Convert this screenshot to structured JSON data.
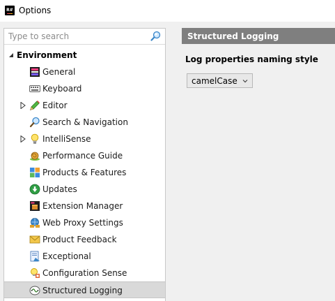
{
  "window": {
    "title": "Options",
    "icon": "resharper-icon",
    "icon_text": "R#"
  },
  "search": {
    "placeholder": "Type to search",
    "value": ""
  },
  "tree": {
    "root": {
      "label": "Environment",
      "expanded": true
    },
    "items": [
      {
        "label": "General",
        "icon": "general-icon",
        "expandable": false
      },
      {
        "label": "Keyboard",
        "icon": "keyboard-icon",
        "expandable": false
      },
      {
        "label": "Editor",
        "icon": "pencil-icon",
        "expandable": true
      },
      {
        "label": "Search & Navigation",
        "icon": "magnifier-icon",
        "expandable": false
      },
      {
        "label": "IntelliSense",
        "icon": "lightbulb-icon",
        "expandable": true
      },
      {
        "label": "Performance Guide",
        "icon": "snail-icon",
        "expandable": false
      },
      {
        "label": "Products & Features",
        "icon": "puzzle-icon",
        "expandable": false
      },
      {
        "label": "Updates",
        "icon": "update-icon",
        "expandable": false
      },
      {
        "label": "Extension Manager",
        "icon": "package-icon",
        "expandable": false
      },
      {
        "label": "Web Proxy Settings",
        "icon": "network-icon",
        "expandable": false
      },
      {
        "label": "Product Feedback",
        "icon": "envelope-icon",
        "expandable": false
      },
      {
        "label": "Exceptional",
        "icon": "exception-icon",
        "expandable": false
      },
      {
        "label": "Configuration Sense",
        "icon": "config-sense-icon",
        "expandable": false
      },
      {
        "label": "Structured Logging",
        "icon": "logging-icon",
        "expandable": false,
        "selected": true
      }
    ]
  },
  "page": {
    "title": "Structured Logging",
    "setting_label": "Log properties naming style",
    "dropdown": {
      "value": "camelCase"
    }
  },
  "colors": {
    "header_bg": "#7f7f7f",
    "selected_bg": "#d9d9d9",
    "window_bg": "#f0f0f0"
  }
}
